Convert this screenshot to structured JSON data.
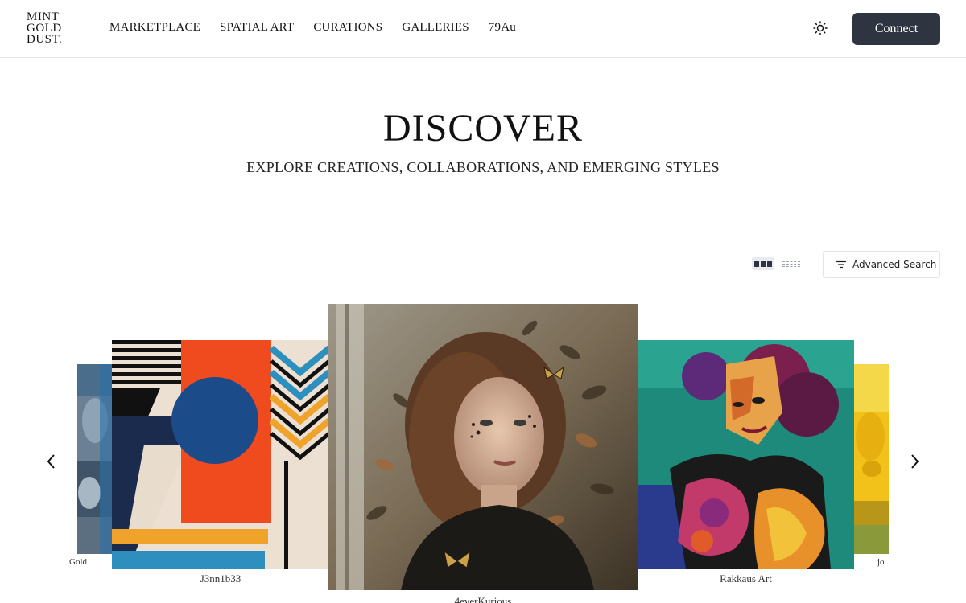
{
  "header": {
    "logo_lines": [
      "MINT",
      "GOLD",
      "DUST."
    ],
    "nav": [
      "MARKETPLACE",
      "SPATIAL ART",
      "CURATIONS",
      "GALLERIES",
      "79Au"
    ],
    "theme_icon": "sun-icon",
    "connect_label": "Connect"
  },
  "hero": {
    "title": "DISCOVER",
    "subtitle": "EXPLORE CREATIONS, COLLABORATIONS, AND EMERGING STYLES"
  },
  "toolbar": {
    "grid_icon": "grid-view-icon",
    "list_icon": "list-view-icon",
    "advanced_search_label": "Advanced Search",
    "filter_icon": "filter-icon"
  },
  "carousel": {
    "prev_icon": "chevron-left-icon",
    "next_icon": "chevron-right-icon",
    "cards": [
      {
        "label": "Gold"
      },
      {
        "label": "J3nn1b33"
      },
      {
        "label": "4everKurious"
      },
      {
        "label": "Rakkaus Art"
      },
      {
        "label": "jo"
      }
    ]
  },
  "colors": {
    "button_dark": "#2f3441",
    "border": "#e5e5e5"
  }
}
